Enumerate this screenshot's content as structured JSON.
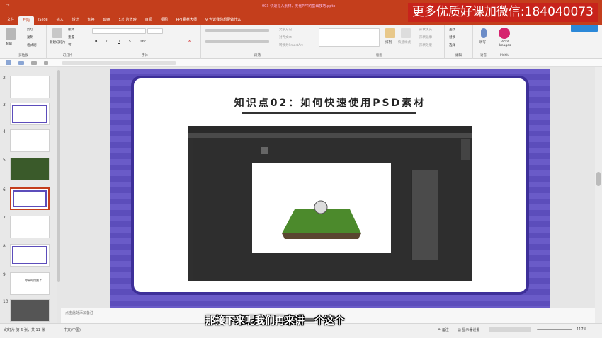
{
  "window": {
    "title": "003-快速导入素材、美化PPT的基础技巧.pptx",
    "quick": [
      "≡",
      "—",
      "□",
      "✕"
    ]
  },
  "watermark": "更多优质好课加微信:184040073",
  "ribbon": {
    "tabs": [
      "文件",
      "开始",
      "iSlide",
      "插入",
      "设计",
      "切换",
      "动画",
      "幻灯片放映",
      "审阅",
      "视图",
      "PPT素材大师",
      "♀ 告诉我你想要做什么"
    ],
    "groups": {
      "clipboard": {
        "label": "剪贴板",
        "items": [
          "粘贴",
          "剪切",
          "复制",
          "格式刷"
        ]
      },
      "slides": {
        "label": "幻灯片",
        "items": [
          "新建幻灯片",
          "版式",
          "重置",
          "节"
        ]
      },
      "font": {
        "label": "字体",
        "items": [
          "B",
          "I",
          "U",
          "S",
          "abc",
          "A"
        ]
      },
      "paragraph": {
        "label": "段落",
        "items": [
          "文字方向",
          "对齐文本",
          "转换为SmartArt"
        ]
      },
      "drawing": {
        "label": "绘图",
        "items": [
          "排列",
          "快速样式",
          "形状填充",
          "形状轮廓",
          "形状效果"
        ]
      },
      "editing": {
        "label": "编辑",
        "items": [
          "查找",
          "替换",
          "选择"
        ]
      },
      "voice": {
        "label": "语音",
        "items": [
          "听写"
        ]
      },
      "pickit": {
        "label": "Pickit",
        "items": [
          "Pickit Images"
        ]
      }
    }
  },
  "slides_panel": {
    "numbers": [
      "2",
      "3",
      "4",
      "5",
      "6",
      "7",
      "8",
      "9",
      "10"
    ],
    "thumb_caption": "你平时用到了"
  },
  "slide": {
    "title": "知识点02：如何快速使用PSD素材"
  },
  "notes": {
    "placeholder": "点击此处添加备注"
  },
  "status": {
    "slide_info": "幻灯片 第 6 张，共 11 张",
    "lang": "中文(中国)",
    "notes_btn": "≙ 备注",
    "comments_btn": "▤ 显示器设置",
    "zoom": "117%"
  },
  "subtitle": "那接下来呢我们再来讲一个这个",
  "colors": {
    "accent": "#c43e1c",
    "slide_bg": "#6a5bc8",
    "slide_border": "#3d2f99",
    "ps_bg": "#3c3c3c"
  }
}
